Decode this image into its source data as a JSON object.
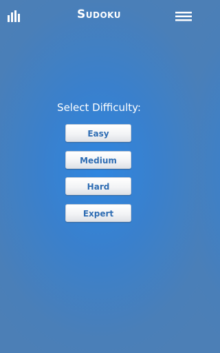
{
  "header": {
    "title": "Sudoku",
    "stats_icon": "bar-chart-icon",
    "menu_icon": "hamburger-menu-icon"
  },
  "main": {
    "prompt": "Select Difficulty:",
    "difficulties": [
      {
        "label": "Easy"
      },
      {
        "label": "Medium"
      },
      {
        "label": "Hard"
      },
      {
        "label": "Expert"
      }
    ]
  },
  "colors": {
    "background_center": "#2f86e0",
    "background_edge": "#4c7fb6",
    "button_text": "#2f6db3",
    "header_text": "#ffffff"
  }
}
